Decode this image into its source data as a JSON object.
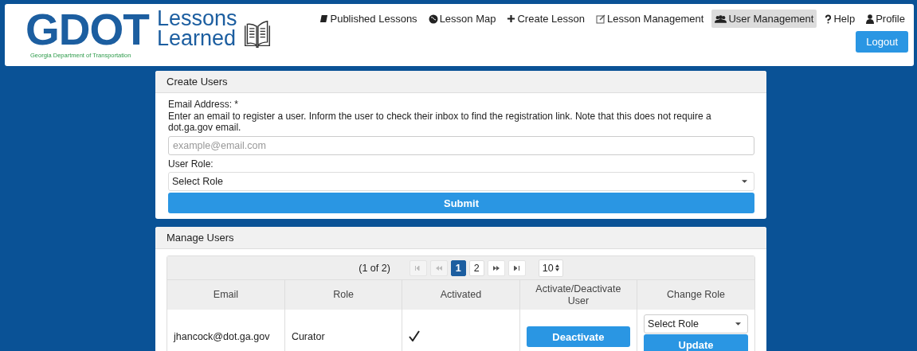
{
  "logo": {
    "mark": "GDOT",
    "agency": "Georgia Department of Transportation",
    "title_lines": [
      "Lessons",
      "Learned"
    ]
  },
  "nav": [
    {
      "label": "Published Lessons",
      "selected": false
    },
    {
      "label": "Lesson Map",
      "selected": false
    },
    {
      "label": "Create Lesson",
      "selected": false
    },
    {
      "label": "Lesson Management",
      "selected": false
    },
    {
      "label": "User Management",
      "selected": true
    },
    {
      "label": "Help",
      "selected": false
    },
    {
      "label": "Profile",
      "selected": false
    }
  ],
  "logout": "Logout",
  "create_users": {
    "title": "Create Users",
    "email_label": "Email Address:  *",
    "help": "Enter an email to register a user. Inform the user to check their inbox to find the registration link. Note that this does not require a dot.ga.gov email.",
    "email_placeholder": "example@email.com",
    "role_label": "User Role:",
    "role_value": "Select Role",
    "submit": "Submit"
  },
  "manage_users": {
    "title": "Manage Users",
    "page_info": "(1 of 2)",
    "pages": [
      {
        "label": "1",
        "selected": true
      },
      {
        "label": "2",
        "selected": false
      }
    ],
    "page_size": "10",
    "columns": [
      "Email",
      "Role",
      "Activated",
      "Activate/Deactivate User",
      "Change Role"
    ],
    "rows": [
      {
        "email": "jhancock@dot.ga.gov",
        "role": "Curator",
        "activated": true,
        "toggle": "Deactivate",
        "role_select": "Select Role",
        "update": "Update"
      }
    ]
  }
}
